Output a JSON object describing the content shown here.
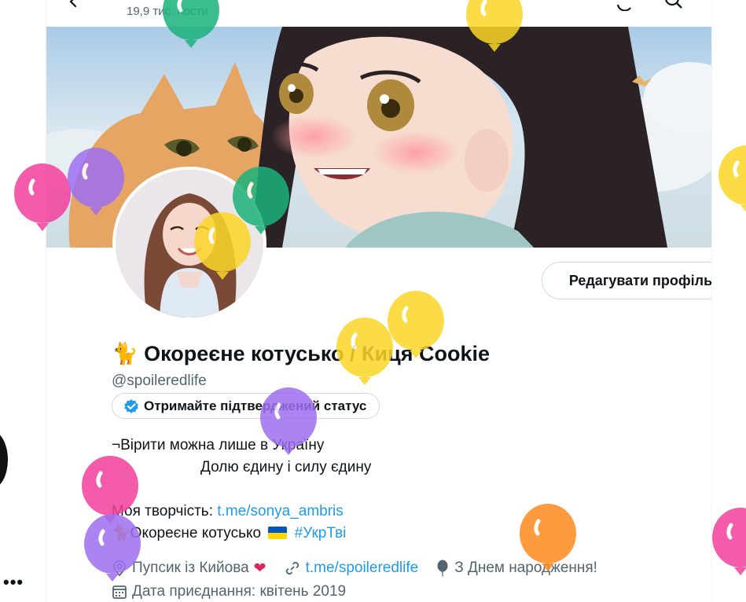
{
  "header": {
    "post_count": "19,9 тис. пости"
  },
  "profile": {
    "emoji": "🐈",
    "display_name": "Окореєне котусько / Киця Cookie",
    "handle": "@spoileredlife",
    "edit_button": "Редагувати профіль",
    "verify_button": "Отримайте підтверджений статус"
  },
  "bio": {
    "line1": "¬Вірити можна лише в Україну",
    "line2": "Долю єдину і силу єдину",
    "line3_prefix": "Моя творчість: ",
    "line3_link": "t.me/sonya_ambris",
    "line4_emoji": "🐈",
    "line4_text": "Окореєне котусько",
    "line4_hashtag": "#УкрТві"
  },
  "meta": {
    "location": "Пупсик із Кийова",
    "location_emoji": "❤",
    "website": "t.me/spoileredlife",
    "birthday": "З Днем народження!",
    "joined": "Дата приєднання: квітень 2019"
  },
  "icons": {
    "back": "arrow-left-icon",
    "topbar_a": "retweet-icon",
    "topbar_b": "search-icon",
    "verified": "verified-badge-icon",
    "location": "location-pin-icon",
    "website": "link-icon",
    "birthday": "balloon-icon",
    "joined": "calendar-icon"
  },
  "colors": {
    "accent": "#1d9bf0",
    "secondary_text": "#536471",
    "balloon_yellow": "#fbd728",
    "balloon_green": "#1bb27a",
    "balloon_purple": "#9d6ff0",
    "balloon_pink": "#f43f9d",
    "balloon_orange": "#ff8a1e"
  }
}
